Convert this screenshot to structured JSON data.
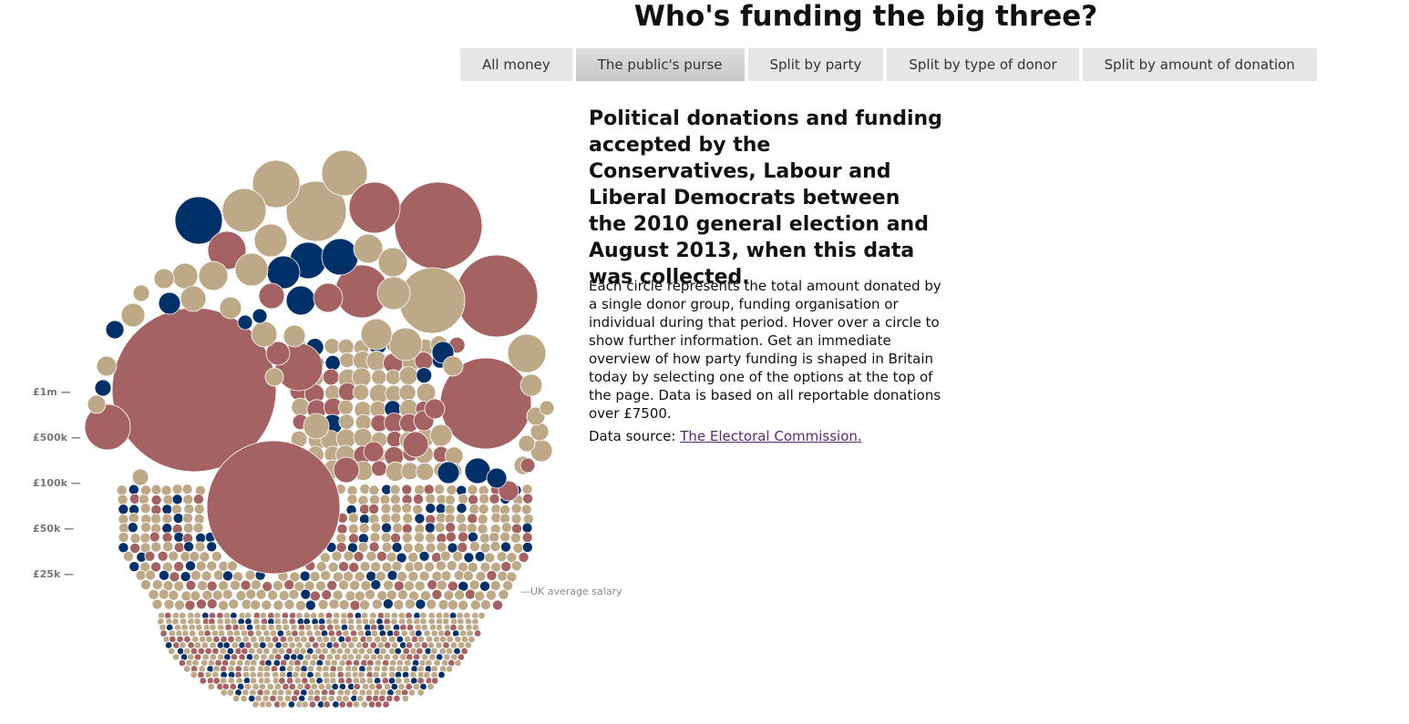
{
  "title": "Who's funding the big three?",
  "tabs": [
    "All money",
    "The public's purse",
    "Split by party",
    "Split by type of donor",
    "Split by amount of donation"
  ],
  "active_tab": 1,
  "heading": "Political donations and funding accepted by the Conservatives, Labour and Liberal Democrats between the 2010 general election and August 2013, when this data was collected.",
  "description": "Each circle represents the total amount donated by a single donor group, funding organisation or individual during that period. Hover over a circle to show further information. Get an immediate overview of how party funding is shaped in Britain today by selecting one of the options at the top of the page. Data is based on all reportable donations over £7500.",
  "source_prefix": "Data source: ",
  "source_link": "The Electoral Commission.",
  "chart_data": {
    "type": "bubble",
    "scale_labels": [
      "£1m —",
      "£500k —",
      "£100k —",
      "£50k —",
      "£25k —"
    ],
    "scale_values": [
      1000000,
      500000,
      100000,
      50000,
      25000
    ],
    "annotation": "—UK average salary",
    "colors": {
      "tan": "#bda888",
      "red": "#a56262",
      "navy": "#003068"
    }
  }
}
